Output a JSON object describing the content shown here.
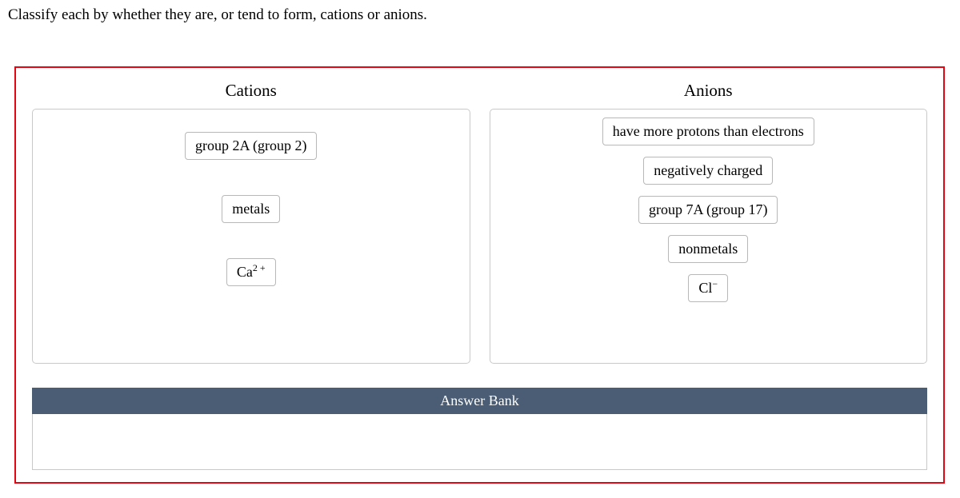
{
  "prompt": "Classify each by whether they are, or tend to form, cations or anions.",
  "columns": {
    "cations": {
      "title": "Cations",
      "items": [
        {
          "label": "group 2A (group 2)",
          "html": false
        },
        {
          "label": "metals",
          "html": false
        },
        {
          "label": "Ca²⁺",
          "html": "Ca<sup>2 +</sup>"
        }
      ]
    },
    "anions": {
      "title": "Anions",
      "items": [
        {
          "label": "have more protons than electrons",
          "html": false
        },
        {
          "label": "negatively charged",
          "html": false
        },
        {
          "label": "group 7A (group 17)",
          "html": false
        },
        {
          "label": "nonmetals",
          "html": false
        },
        {
          "label": "Cl⁻",
          "html": "Cl<sup>−</sup>"
        }
      ]
    }
  },
  "answerBank": {
    "title": "Answer Bank",
    "items": []
  }
}
